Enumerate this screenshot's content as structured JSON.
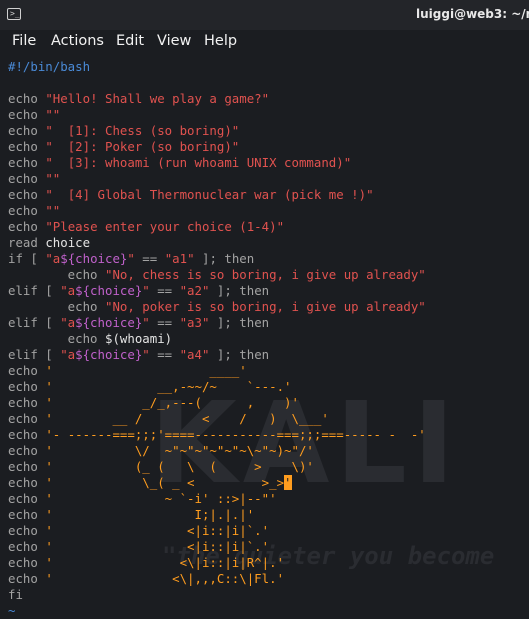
{
  "window": {
    "title": "luiggi@web3: ~/mor"
  },
  "menu": [
    "File",
    "Actions",
    "Edit",
    "View",
    "Help"
  ],
  "watermark": {
    "logo_text": "KALI",
    "tagline": "\"the quieter you become"
  },
  "editor": {
    "lines": [
      [
        [
          "cmt",
          "#!/bin/bash"
        ]
      ],
      [],
      [
        [
          "kw",
          "echo "
        ],
        [
          "str",
          "\"Hello! Shall we play a game?\""
        ]
      ],
      [
        [
          "kw",
          "echo "
        ],
        [
          "str",
          "\"\""
        ]
      ],
      [
        [
          "kw",
          "echo "
        ],
        [
          "str",
          "\"  [1]: Chess (so boring)\""
        ]
      ],
      [
        [
          "kw",
          "echo "
        ],
        [
          "str",
          "\"  [2]: Poker (so boring)\""
        ]
      ],
      [
        [
          "kw",
          "echo "
        ],
        [
          "str",
          "\"  [3]: whoami (run whoami UNIX command)\""
        ]
      ],
      [
        [
          "kw",
          "echo "
        ],
        [
          "str",
          "\"\""
        ]
      ],
      [
        [
          "kw",
          "echo "
        ],
        [
          "str",
          "\"  [4] Global Thermonuclear war (pick me !)\""
        ]
      ],
      [
        [
          "kw",
          "echo "
        ],
        [
          "str",
          "\"\""
        ]
      ],
      [
        [
          "kw",
          "echo "
        ],
        [
          "str",
          "\"Please enter your choice (1-4)\""
        ]
      ],
      [
        [
          "kw",
          "read "
        ],
        [
          "plain",
          "choice"
        ]
      ],
      [
        [
          "kw",
          "if [ "
        ],
        [
          "str",
          "\"a"
        ],
        [
          "var",
          "${choice}"
        ],
        [
          "str",
          "\""
        ],
        [
          "kw",
          " == "
        ],
        [
          "str",
          "\"a1\""
        ],
        [
          "kw",
          " ]; then"
        ]
      ],
      [
        [
          "kw",
          "        echo "
        ],
        [
          "str",
          "\"No, chess is so boring, i give up already\""
        ]
      ],
      [
        [
          "kw",
          "elif [ "
        ],
        [
          "str",
          "\"a"
        ],
        [
          "var",
          "${choice}"
        ],
        [
          "str",
          "\""
        ],
        [
          "kw",
          " == "
        ],
        [
          "str",
          "\"a2\""
        ],
        [
          "kw",
          " ]; then"
        ]
      ],
      [
        [
          "kw",
          "        echo "
        ],
        [
          "str",
          "\"No, poker is so boring, i give up already\""
        ]
      ],
      [
        [
          "kw",
          "elif [ "
        ],
        [
          "str",
          "\"a"
        ],
        [
          "var",
          "${choice}"
        ],
        [
          "str",
          "\""
        ],
        [
          "kw",
          " == "
        ],
        [
          "str",
          "\"a3\""
        ],
        [
          "kw",
          " ]; then"
        ]
      ],
      [
        [
          "kw",
          "        echo "
        ],
        [
          "plain",
          "$(whoami)"
        ]
      ],
      [
        [
          "kw",
          "elif [ "
        ],
        [
          "str",
          "\"a"
        ],
        [
          "var",
          "${choice}"
        ],
        [
          "str",
          "\""
        ],
        [
          "kw",
          " == "
        ],
        [
          "str",
          "\"a4\""
        ],
        [
          "kw",
          " ]; then"
        ]
      ],
      [
        [
          "kw",
          "echo "
        ],
        [
          "art",
          "'                     ____'"
        ]
      ],
      [
        [
          "kw",
          "echo "
        ],
        [
          "art",
          "'              __,-~~/~    `---.'"
        ]
      ],
      [
        [
          "kw",
          "echo "
        ],
        [
          "art",
          "'            _/_,---(      ,    )'"
        ]
      ],
      [
        [
          "kw",
          "echo "
        ],
        [
          "art",
          "'        __ /        <    /   )  \\___'"
        ]
      ],
      [
        [
          "kw",
          "echo "
        ],
        [
          "art",
          "'- ------===;;;'====-----------===;;;===----- -  -'"
        ]
      ],
      [
        [
          "kw",
          "echo "
        ],
        [
          "art",
          "'           \\/  ~\"~\"~\"~\"~\"~\\~\"~)~\"/'"
        ]
      ],
      [
        [
          "kw",
          "echo "
        ],
        [
          "art",
          "'           (_ (   \\  (     >    \\)'"
        ]
      ],
      [
        [
          "kw",
          "echo "
        ],
        [
          "art",
          "'            \\_( _ <         >_>"
        ],
        [
          "cursor",
          "'"
        ]
      ],
      [
        [
          "kw",
          "echo "
        ],
        [
          "art",
          "'               ~ `-i' ::>|--\"'"
        ]
      ],
      [
        [
          "kw",
          "echo "
        ],
        [
          "art",
          "'                   I;|.|.|'"
        ]
      ],
      [
        [
          "kw",
          "echo "
        ],
        [
          "art",
          "'                  <|i::|i|`.'"
        ]
      ],
      [
        [
          "kw",
          "echo "
        ],
        [
          "art",
          "'                  <|i::|i|`.'"
        ]
      ],
      [
        [
          "kw",
          "echo "
        ],
        [
          "art",
          "'                 <\\|i::|i|R^|.'"
        ]
      ],
      [
        [
          "kw",
          "echo "
        ],
        [
          "art",
          "'                <\\|,,,C::\\|Fl.'"
        ]
      ],
      [
        [
          "kw",
          "fi"
        ]
      ],
      [
        [
          "cmt",
          "~"
        ]
      ]
    ]
  },
  "colors": {
    "background": "#1b1d21",
    "keyword": "#a3a3a3",
    "string": "#e0524f",
    "variable": "#c061cb",
    "comment": "#4a8ad6",
    "ascii_art": "#ff9d1f"
  }
}
